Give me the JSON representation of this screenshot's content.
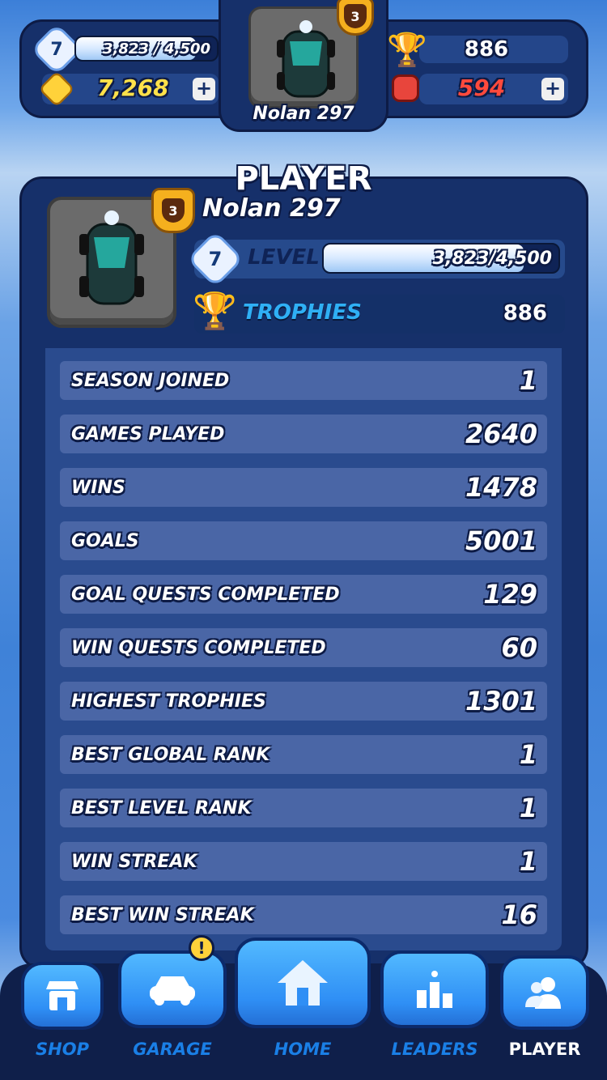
{
  "hud": {
    "level": "7",
    "xp_text": "3,823 / 4,500",
    "xp_progress": 0.85,
    "coins": "7,268",
    "trophies": "886",
    "gems": "594",
    "player_name": "Nolan 297",
    "rank_badge": "3"
  },
  "panel": {
    "title": "PLAYER",
    "player_name": "Nolan 297",
    "rank_badge": "3",
    "level": "7",
    "level_label": "LEVEL",
    "xp_text": "3,823/4,500",
    "xp_progress": 0.85,
    "trophies_label": "TROPHIES",
    "trophies_value": "886"
  },
  "stats": [
    {
      "label": "SEASON JOINED",
      "value": "1"
    },
    {
      "label": "GAMES PLAYED",
      "value": "2640"
    },
    {
      "label": "WINS",
      "value": "1478"
    },
    {
      "label": "GOALS",
      "value": "5001"
    },
    {
      "label": "GOAL QUESTS COMPLETED",
      "value": "129"
    },
    {
      "label": "WIN QUESTS COMPLETED",
      "value": "60"
    },
    {
      "label": "HIGHEST TROPHIES",
      "value": "1301"
    },
    {
      "label": "BEST GLOBAL RANK",
      "value": "1"
    },
    {
      "label": "BEST LEVEL RANK",
      "value": "1"
    },
    {
      "label": "WIN STREAK",
      "value": "1"
    },
    {
      "label": "BEST WIN STREAK",
      "value": "16"
    }
  ],
  "nav": {
    "shop": "SHOP",
    "garage": "GARAGE",
    "home": "HOME",
    "leaders": "LEADERS",
    "player": "PLAYER",
    "garage_alert": "!"
  },
  "colors": {
    "panel": "#16306a",
    "accent_blue": "#2fb0f5",
    "gem_red": "#e8453c",
    "coin_yellow": "#ffd23a"
  }
}
